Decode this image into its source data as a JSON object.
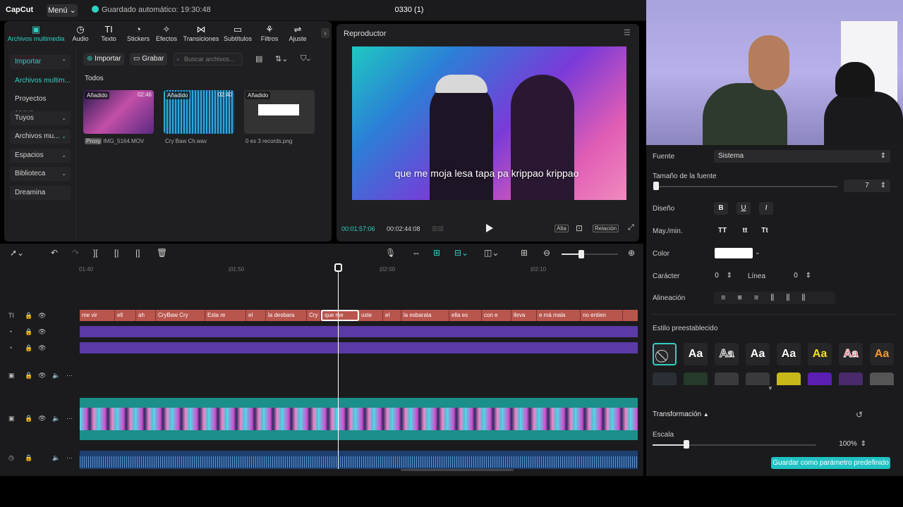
{
  "app": {
    "logo": "CapCut",
    "menu": "Menú",
    "autosave": "Guardado automático: 19:30:48",
    "project": "0330 (1)"
  },
  "tool_tabs": [
    {
      "label": "Archivos multimedia",
      "icon": "media-icon"
    },
    {
      "label": "Audio",
      "icon": "audio-icon"
    },
    {
      "label": "Texto",
      "icon": "text-icon"
    },
    {
      "label": "Stickers",
      "icon": "sticker-icon"
    },
    {
      "label": "Efectos",
      "icon": "effects-icon"
    },
    {
      "label": "Transiciones",
      "icon": "transitions-icon"
    },
    {
      "label": "Subtítulos",
      "icon": "subtitles-icon"
    },
    {
      "label": "Filtros",
      "icon": "filters-icon"
    },
    {
      "label": "Ajuste",
      "icon": "adjust-icon"
    }
  ],
  "side_nav": [
    {
      "label": "Importar"
    },
    {
      "label": "Archivos multim..."
    },
    {
      "label": "Proyectos secun..."
    },
    {
      "label": "Tuyos"
    },
    {
      "label": "Archivos mu..."
    },
    {
      "label": "Espacios"
    },
    {
      "label": "Biblioteca"
    },
    {
      "label": "Dreamina"
    }
  ],
  "media_toolbar": {
    "import": "Importar",
    "record": "Grabar",
    "search_placeholder": "Buscar archivos..."
  },
  "media": {
    "section": "Todos",
    "items": [
      {
        "name": "IMG_5164.MOV",
        "badge": "Añadido",
        "duration": "02:46",
        "proxy": "Proxy"
      },
      {
        "name": "Cry Baw Ch.wav",
        "badge": "Añadido",
        "duration": "02:40"
      },
      {
        "name": "0 es 3 records.png",
        "badge": "Añadido"
      }
    ]
  },
  "player": {
    "title": "Reproductor",
    "subtitle": "que me moja lesa tapa pa krippao krippao",
    "time_current": "00:01:57:06",
    "time_total": "00:02:44:08",
    "quality": "Alta",
    "ratio": "Relación"
  },
  "timeline": {
    "ruler": [
      "01:40",
      "|01:50",
      "|02:00",
      "|02:10"
    ],
    "sub_clips": [
      "me vir",
      "ell",
      "ah",
      "CryBaw Cry",
      "Esta re",
      "el",
      "la desbara",
      "Cry",
      "que me",
      "uste",
      "el",
      "la esbarata",
      "ella es",
      "con e",
      "lleva",
      "e má mala",
      "no entien"
    ]
  },
  "props": {
    "font_label": "Fuente",
    "font_value": "Sistema",
    "size_label": "Tamaño de la fuente",
    "size_value": "7",
    "design_label": "Diseño",
    "case_label": "May./min.",
    "case_options": [
      "TT",
      "tt",
      "Tt"
    ],
    "color_label": "Color",
    "char_label": "Carácter",
    "char_value": "0",
    "line_label": "Línea",
    "line_value": "0",
    "align_label": "Alineación",
    "preset_label": "Estilo preestablecido",
    "presets_sample": "Aa",
    "transform_label": "Transformación",
    "scale_label": "Escala",
    "scale_value": "100%",
    "save_preset": "Guardar como parámetro predefinido"
  },
  "colors": {
    "accent": "#2fd0c0",
    "subtitle_track": "#b8554d",
    "purple_track": "#5a3aa6",
    "video_track": "#1b8f8a",
    "audio_track": "#1c3f70"
  }
}
